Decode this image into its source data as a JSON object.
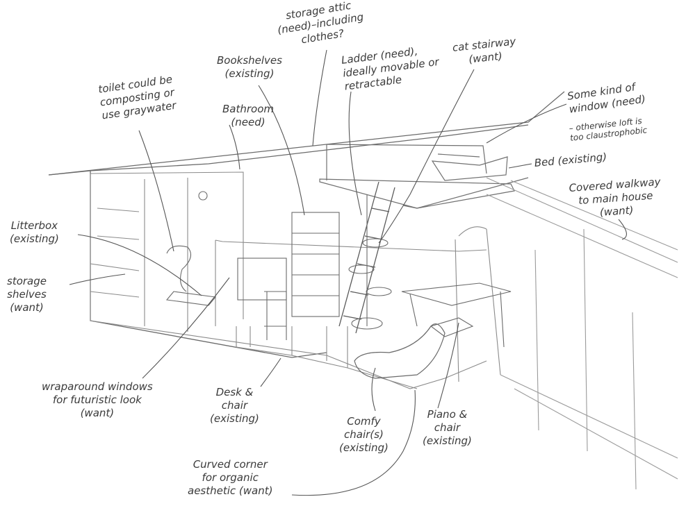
{
  "labels": {
    "storage_attic": "storage attic\n(need)–including\nclothes?",
    "bookshelves": "Bookshelves\n(existing)",
    "ladder": "Ladder (need),\nideally movable or\nretractable",
    "cat_stairway": "cat stairway\n(want)",
    "toilet": "toilet could be\ncomposting or\nuse graywater",
    "bathroom": "Bathroom\n(need)",
    "window": "Some kind of\nwindow (need)",
    "window_note": "– otherwise loft is\ntoo claustrophobic",
    "bed": "Bed (existing)",
    "walkway": "Covered walkway\nto main house\n(want)",
    "litterbox": "Litterbox\n(existing)",
    "storage_shelves": "storage\nshelves\n(want)",
    "wraparound": "wraparound windows\nfor futuristic look\n(want)",
    "desk_chair": "Desk &\nchair\n(existing)",
    "comfy_chairs": "Comfy\nchair(s)\n(existing)",
    "piano_chair": "Piano &\nchair\n(existing)",
    "curved_corner": "Curved corner\nfor organic\naesthetic (want)"
  }
}
